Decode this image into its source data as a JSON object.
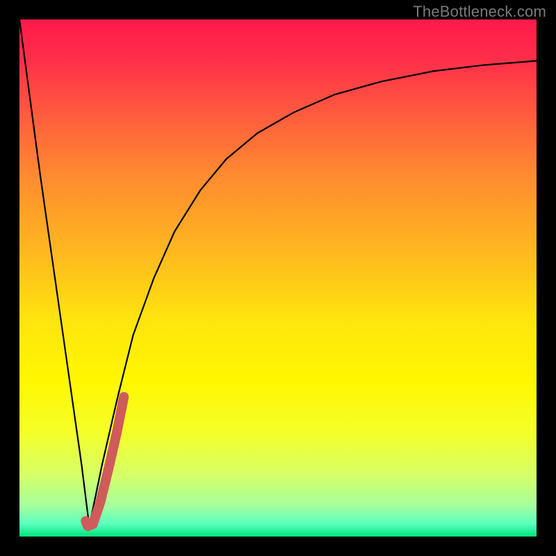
{
  "watermark": "TheBottleneck.com",
  "chart_data": {
    "type": "line",
    "title": "",
    "xlabel": "",
    "ylabel": "",
    "xlim": [
      0,
      100
    ],
    "ylim": [
      0,
      100
    ],
    "gradient_stops": [
      {
        "pos": 0.0,
        "color": "#ff1a4b"
      },
      {
        "pos": 0.08,
        "color": "#ff2f49"
      },
      {
        "pos": 0.18,
        "color": "#ff5a3e"
      },
      {
        "pos": 0.3,
        "color": "#ff8a30"
      },
      {
        "pos": 0.45,
        "color": "#ffb81f"
      },
      {
        "pos": 0.58,
        "color": "#ffe40e"
      },
      {
        "pos": 0.7,
        "color": "#fff700"
      },
      {
        "pos": 0.8,
        "color": "#f4ff2a"
      },
      {
        "pos": 0.88,
        "color": "#d6ff66"
      },
      {
        "pos": 0.94,
        "color": "#a6ff9c"
      },
      {
        "pos": 0.975,
        "color": "#5cffc0"
      },
      {
        "pos": 1.0,
        "color": "#00e57a"
      }
    ],
    "series": [
      {
        "name": "bottleneck-left",
        "color": "#000000",
        "width": 2.2,
        "x": [
          0,
          2,
          4,
          6,
          8,
          10,
          12,
          13.5
        ],
        "y": [
          100,
          85,
          70,
          56,
          42,
          28,
          14,
          2
        ]
      },
      {
        "name": "bottleneck-right",
        "color": "#000000",
        "width": 2.2,
        "x": [
          13.5,
          16,
          19,
          22,
          26,
          30,
          35,
          40,
          46,
          53,
          61,
          70,
          80,
          90,
          100
        ],
        "y": [
          2,
          14,
          27,
          39,
          50,
          59,
          67,
          73,
          78,
          82,
          85.5,
          88,
          90,
          91.2,
          92
        ]
      },
      {
        "name": "highlight-marker",
        "color": "#cf5b5b",
        "width": 14,
        "linecap": "round",
        "x": [
          12.8,
          13.2,
          14.2,
          15.6,
          17.2,
          18.8,
          20.2
        ],
        "y": [
          3.0,
          2.0,
          2.4,
          6.5,
          13.0,
          20.0,
          27.0
        ]
      }
    ]
  }
}
